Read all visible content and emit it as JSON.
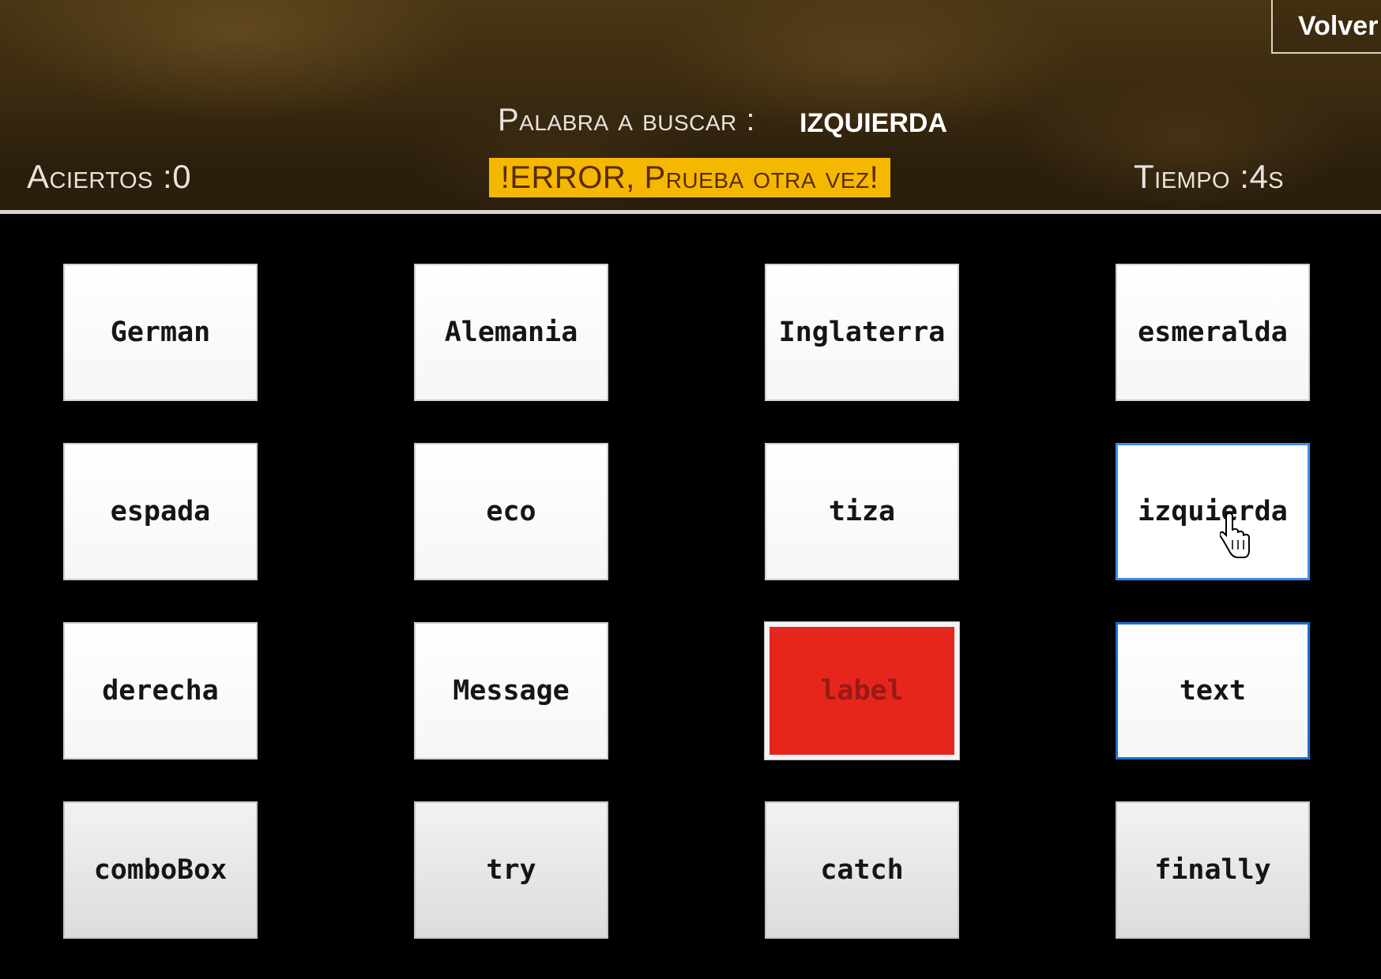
{
  "header": {
    "back_label": "Volver",
    "search_prompt": "Palabra a buscar :",
    "search_word": "IZQUIERDA",
    "hits_label": "Aciertos :0",
    "time_label": "Tiempo :4s",
    "error_message": "!ERROR, Prueba otra vez!"
  },
  "grid": {
    "words": [
      "German",
      "Alemania",
      "Inglaterra",
      "esmeralda",
      "espada",
      "eco",
      "tiza",
      "izquierda",
      "derecha",
      "Message",
      "label",
      "text",
      "comboBox",
      "try",
      "catch",
      "finally"
    ],
    "wrong_tile": "label",
    "hovered_tile": "izquierda",
    "focused_tile": "text"
  },
  "colors": {
    "error_banner": "#f5b800",
    "wrong_tile": "#e6261d",
    "focus_border": "#1e6fd0",
    "background": "#000000"
  },
  "icons": {
    "cursor": "hand-pointer-icon"
  }
}
